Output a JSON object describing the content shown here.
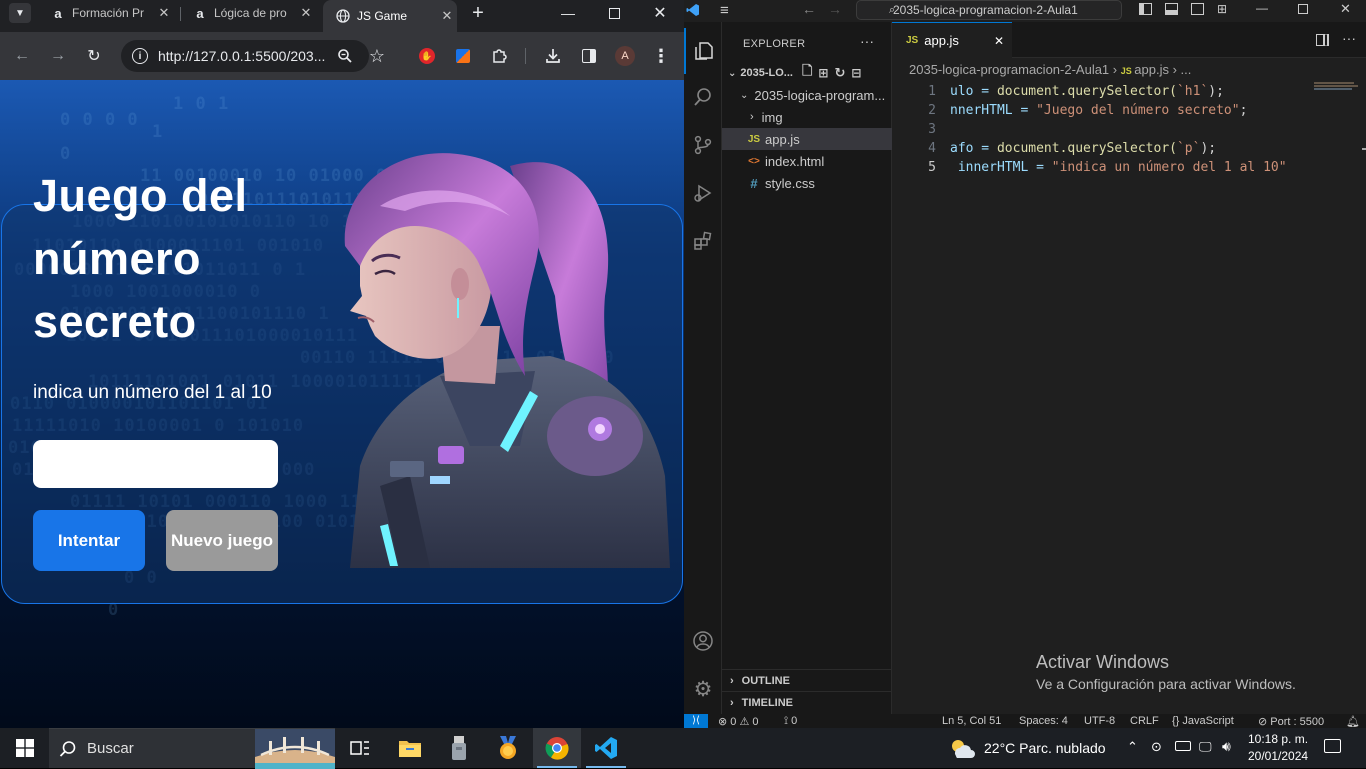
{
  "browser": {
    "tabs": [
      {
        "title": "Formación Pr",
        "favicon": "alura-icon"
      },
      {
        "title": "Lógica de pro",
        "favicon": "alura-icon"
      },
      {
        "title": "JS Game",
        "favicon": "globe-icon"
      }
    ],
    "new_tab": "+",
    "url": "http://127.0.0.1:5500/203...",
    "profile_initial": "A"
  },
  "game": {
    "title": "Juego del número secreto",
    "title_lines": [
      "Juego del",
      "número",
      "secreto"
    ],
    "paragraph": "indica un número del 1 al 10",
    "input_value": "",
    "try_label": "Intentar",
    "new_game_label": "Nuevo juego",
    "binary_rows": [
      "1   0   1",
      "0       0       0  0",
      "1",
      "0",
      "11 00100010  10 01000 000001",
      "0101101110101110 0 01",
      "1000   110100101010110 10 1",
      "11010110  0100011101 001010",
      "0000010111  00101011011 0 1",
      "1000  1001000010 0",
      "0100010110011100101110 1",
      "10001 00 10011101000010111",
      "00110 11111 01111110   0111 00",
      "10111101001 01011 100001011111",
      "0110 010000101101101 01",
      "11111010 10100001 0 101010",
      "0100111100101010100011 0",
      "01011000010 1000000 001 000",
      "01111 10101 000110 1000 110 000101 11011",
      "10100 010 11 10110100 0101100101 010 0110 0",
      "1   1      1",
      "0       0",
      "0"
    ],
    "hero_image": "cyberpunk-girl-illustration"
  },
  "vscode": {
    "title_search": "2035-logica-programacion-2-Aula1",
    "explorer_label": "EXPLORER",
    "workspace": "2035-LO...",
    "folder": "2035-logica-program...",
    "files": [
      {
        "name": "img",
        "type": "folder"
      },
      {
        "name": "app.js",
        "type": "js",
        "selected": true
      },
      {
        "name": "index.html",
        "type": "html"
      },
      {
        "name": "style.css",
        "type": "css"
      }
    ],
    "outline": "OUTLINE",
    "timeline": "TIMELINE",
    "editor_tab": "app.js",
    "breadcrumb_folder": "2035-logica-programacion-2-Aula1",
    "breadcrumb_file": "app.js",
    "breadcrumb_more": "...",
    "code_lines": [
      {
        "n": "1",
        "pre": "ulo = ",
        "fn": "document.querySelector(",
        "str": "`h1`",
        "post": ");"
      },
      {
        "n": "2",
        "pre": "nnerHTML = ",
        "fn": "",
        "str": "\"Juego del número secreto\"",
        "post": ";"
      },
      {
        "n": "3",
        "pre": "",
        "fn": "",
        "str": "",
        "post": ""
      },
      {
        "n": "4",
        "pre": "afo = ",
        "fn": "document.querySelector(",
        "str": "`p`",
        "post": ");"
      },
      {
        "n": "5",
        "pre": " innerHTML = ",
        "fn": "",
        "str": "\"indica un número del 1 al 10\"",
        "post": ""
      }
    ],
    "activate_title": "Activar Windows",
    "activate_sub": "Ve a Configuración para activar Windows.",
    "status": {
      "errors": "⊗ 0 ⚠ 0",
      "ports": "⟟ 0",
      "position": "Ln 5, Col 51",
      "spaces": "Spaces: 4",
      "encoding": "UTF-8",
      "eol": "CRLF",
      "language": "{} JavaScript",
      "live": "⊘ Port : 5500"
    }
  },
  "taskbar": {
    "search": "Buscar",
    "weather": "22°C  Parc. nublado",
    "time": "10:18 p. m.",
    "date": "20/01/2024"
  }
}
